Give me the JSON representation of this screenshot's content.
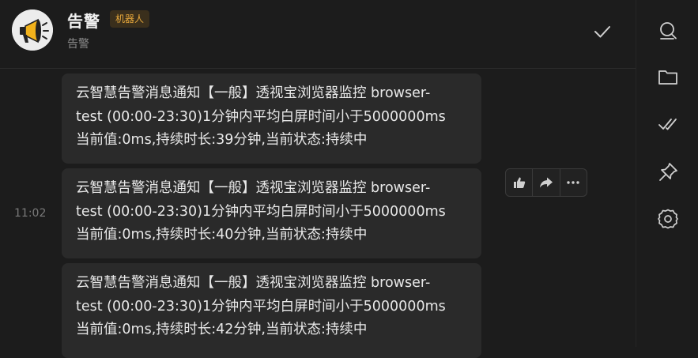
{
  "header": {
    "title": "告警",
    "badge": "机器人",
    "subtitle": "告警",
    "avatar_icon": "megaphone-icon",
    "done_icon": "check-icon"
  },
  "sidebar": {
    "items": [
      {
        "icon": "search-icon"
      },
      {
        "icon": "folder-icon"
      },
      {
        "icon": "double-check-icon"
      },
      {
        "icon": "pin-icon"
      },
      {
        "icon": "gear-icon"
      }
    ]
  },
  "messages": {
    "time": "11:02",
    "items": [
      {
        "text": "云智慧告警消息通知【一般】透视宝浏览器监控 browser-\ntest (00:00-23:30)1分钟内平均白屏时间小于5000000ms\n当前值:0ms,持续时长:39分钟,当前状态:持续中"
      },
      {
        "text": "云智慧告警消息通知【一般】透视宝浏览器监控 browser-\ntest (00:00-23:30)1分钟内平均白屏时间小于5000000ms\n当前值:0ms,持续时长:40分钟,当前状态:持续中"
      },
      {
        "text": "云智慧告警消息通知【一般】透视宝浏览器监控 browser-\ntest (00:00-23:30)1分钟内平均白屏时间小于5000000ms\n当前值:0ms,持续时长:42分钟,当前状态:持续中"
      }
    ]
  },
  "hover_toolbar": {
    "items": [
      {
        "icon": "thumbs-up-icon"
      },
      {
        "icon": "forward-icon"
      },
      {
        "icon": "more-icon"
      }
    ]
  },
  "colors": {
    "background": "#1c1c1c",
    "bubble": "#2a2a2a",
    "badge_text": "#e8a93c",
    "badge_bg": "#3a2f1c"
  }
}
